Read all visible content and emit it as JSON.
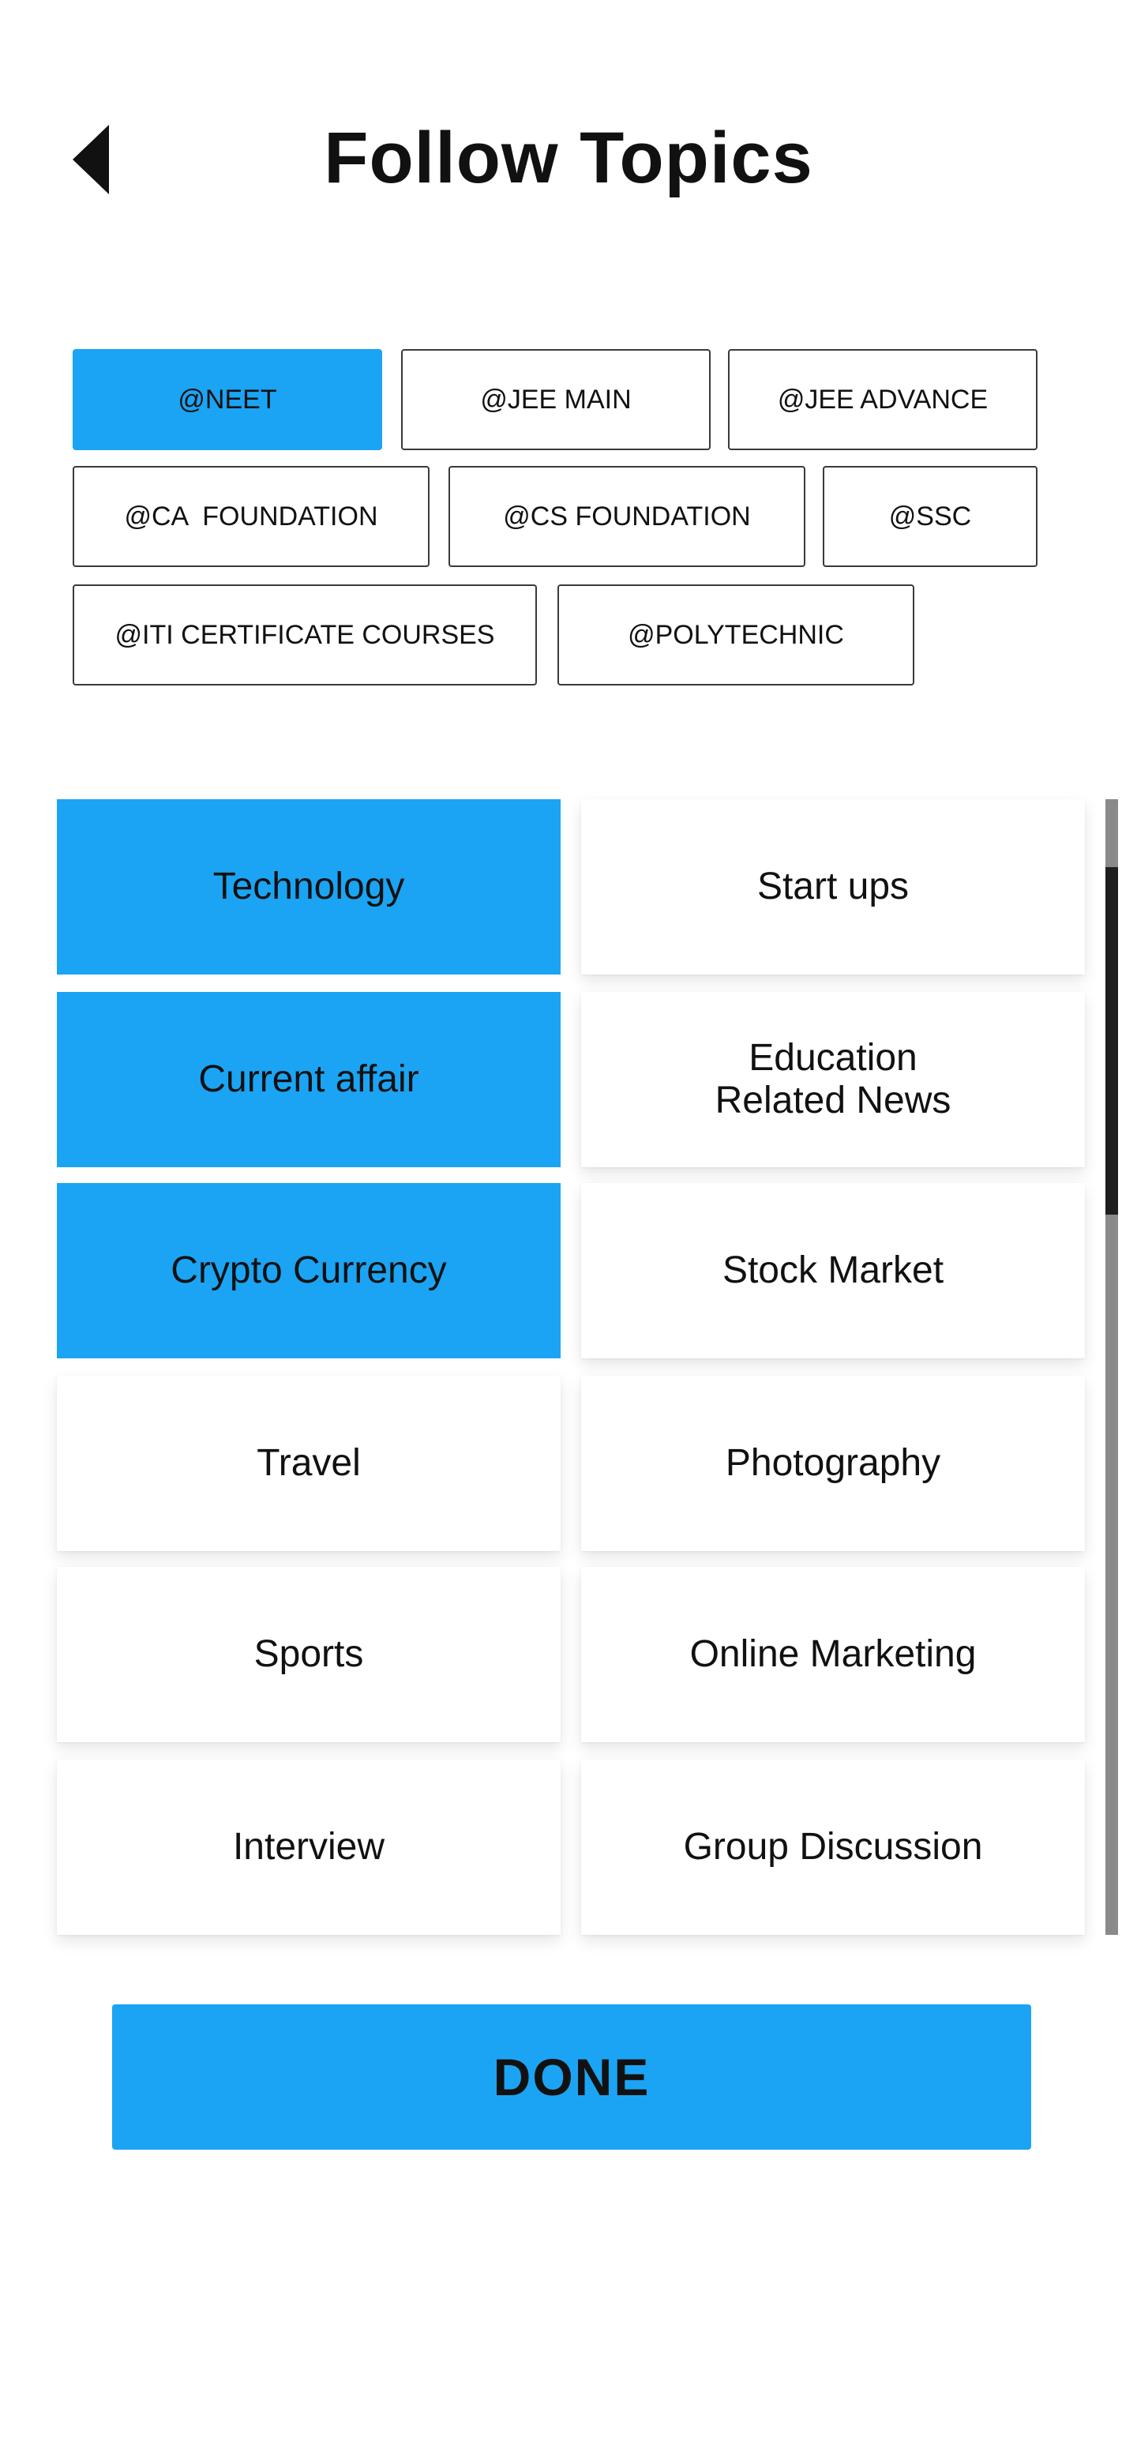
{
  "header": {
    "title": "Follow Topics",
    "back_icon": "back-arrow-icon"
  },
  "exams": [
    {
      "label": "@NEET",
      "selected": true
    },
    {
      "label": "@JEE MAIN",
      "selected": false
    },
    {
      "label": "@JEE ADVANCE",
      "selected": false
    },
    {
      "label": "@CA  FOUNDATION",
      "selected": false
    },
    {
      "label": "@CS FOUNDATION",
      "selected": false
    },
    {
      "label": "@SSC",
      "selected": false
    },
    {
      "label": "@ITI CERTIFICATE COURSES",
      "selected": false
    },
    {
      "label": "@POLYTECHNIC",
      "selected": false
    }
  ],
  "topics": [
    {
      "label": "Technology",
      "selected": true
    },
    {
      "label": "Start ups",
      "selected": false
    },
    {
      "label": "Current affair",
      "selected": true
    },
    {
      "label": "Education\nRelated News",
      "selected": false
    },
    {
      "label": "Crypto Currency",
      "selected": true
    },
    {
      "label": "Stock Market",
      "selected": false
    },
    {
      "label": "Travel",
      "selected": false
    },
    {
      "label": "Photography",
      "selected": false
    },
    {
      "label": "Sports",
      "selected": false
    },
    {
      "label": "Online Marketing",
      "selected": false
    },
    {
      "label": "Interview",
      "selected": false
    },
    {
      "label": "Group Discussion",
      "selected": false
    }
  ],
  "done_label": "DONE",
  "colors": {
    "accent": "#1ba4f4",
    "text": "#111111",
    "background": "#ffffff"
  }
}
